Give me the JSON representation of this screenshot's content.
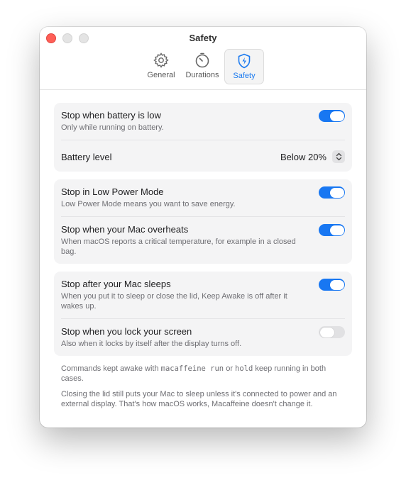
{
  "window": {
    "title": "Safety"
  },
  "tabs": [
    {
      "label": "General",
      "icon": "gear-icon"
    },
    {
      "label": "Durations",
      "icon": "timer-icon"
    },
    {
      "label": "Safety",
      "icon": "shield-bolt-icon"
    }
  ],
  "battery_group": {
    "low_battery": {
      "title": "Stop when battery is low",
      "desc": "Only while running on battery.",
      "on": true
    },
    "battery_level": {
      "label": "Battery level",
      "value": "Below 20%"
    }
  },
  "power_group": {
    "low_power": {
      "title": "Stop in Low Power Mode",
      "desc": "Low Power Mode means you want to save energy.",
      "on": true
    },
    "overheat": {
      "title": "Stop when your Mac overheats",
      "desc": "When macOS reports a critical temperature, for example in a closed bag.",
      "on": true
    }
  },
  "sleep_group": {
    "sleeps": {
      "title": "Stop after your Mac sleeps",
      "desc": "When you put it to sleep or close the lid, Keep Awake is off after it wakes up.",
      "on": true
    },
    "lock": {
      "title": "Stop when you lock your screen",
      "desc": "Also when it locks by itself after the display turns off.",
      "on": false
    }
  },
  "footnotes": {
    "note1_pre": "Commands kept awake with ",
    "note1_code1": "macaffeine run",
    "note1_mid": " or ",
    "note1_code2": "hold",
    "note1_post": " keep running in both cases.",
    "note2": "Closing the lid still puts your Mac to sleep unless it's connected to power and an external display. That's how macOS works, Macaffeine doesn't change it."
  },
  "colors": {
    "accent": "#1877f2",
    "close": "#fe5f57"
  }
}
